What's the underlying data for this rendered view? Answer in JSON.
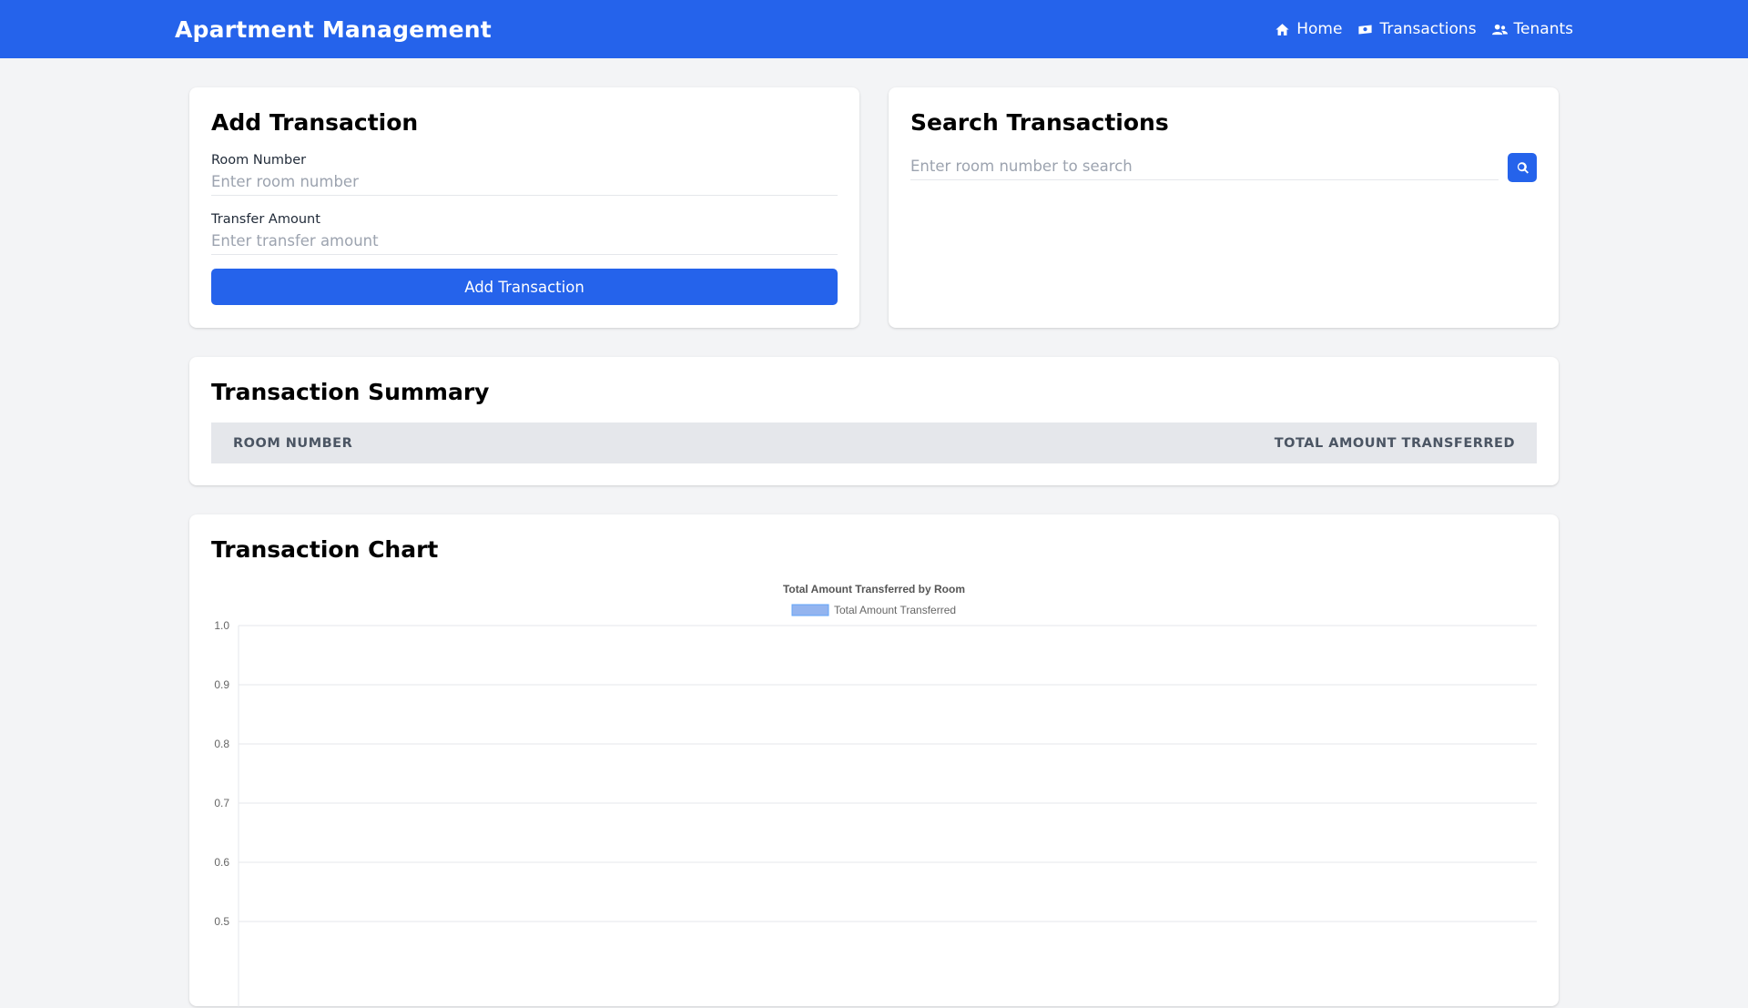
{
  "app": {
    "title": "Apartment Management",
    "accent_color": "#2563eb"
  },
  "nav": {
    "items": [
      {
        "label": "Home",
        "icon": "home-icon"
      },
      {
        "label": "Transactions",
        "icon": "money-bill-icon"
      },
      {
        "label": "Tenants",
        "icon": "users-icon"
      }
    ]
  },
  "add_transaction": {
    "title": "Add Transaction",
    "room_label": "Room Number",
    "room_value": "",
    "room_placeholder": "Enter room number",
    "amount_label": "Transfer Amount",
    "amount_value": "",
    "amount_placeholder": "Enter transfer amount",
    "submit_label": "Add Transaction"
  },
  "search": {
    "title": "Search Transactions",
    "value": "",
    "placeholder": "Enter room number to search",
    "button_icon": "search-icon"
  },
  "summary": {
    "title": "Transaction Summary",
    "columns": [
      "Room Number",
      "Total Amount Transferred"
    ],
    "rows": []
  },
  "chart_section": {
    "title": "Transaction Chart"
  },
  "chart_data": {
    "type": "bar",
    "title": "Total Amount Transferred by Room",
    "categories": [],
    "series": [
      {
        "name": "Total Amount Transferred",
        "values": [],
        "color": "#93b4ef",
        "border_color": "#60a5fa"
      }
    ],
    "ylim": [
      0,
      1.0
    ],
    "yticks": [
      1.0,
      0.9,
      0.8,
      0.7,
      0.6,
      0.5
    ],
    "grid": true,
    "legend": "top-center"
  }
}
